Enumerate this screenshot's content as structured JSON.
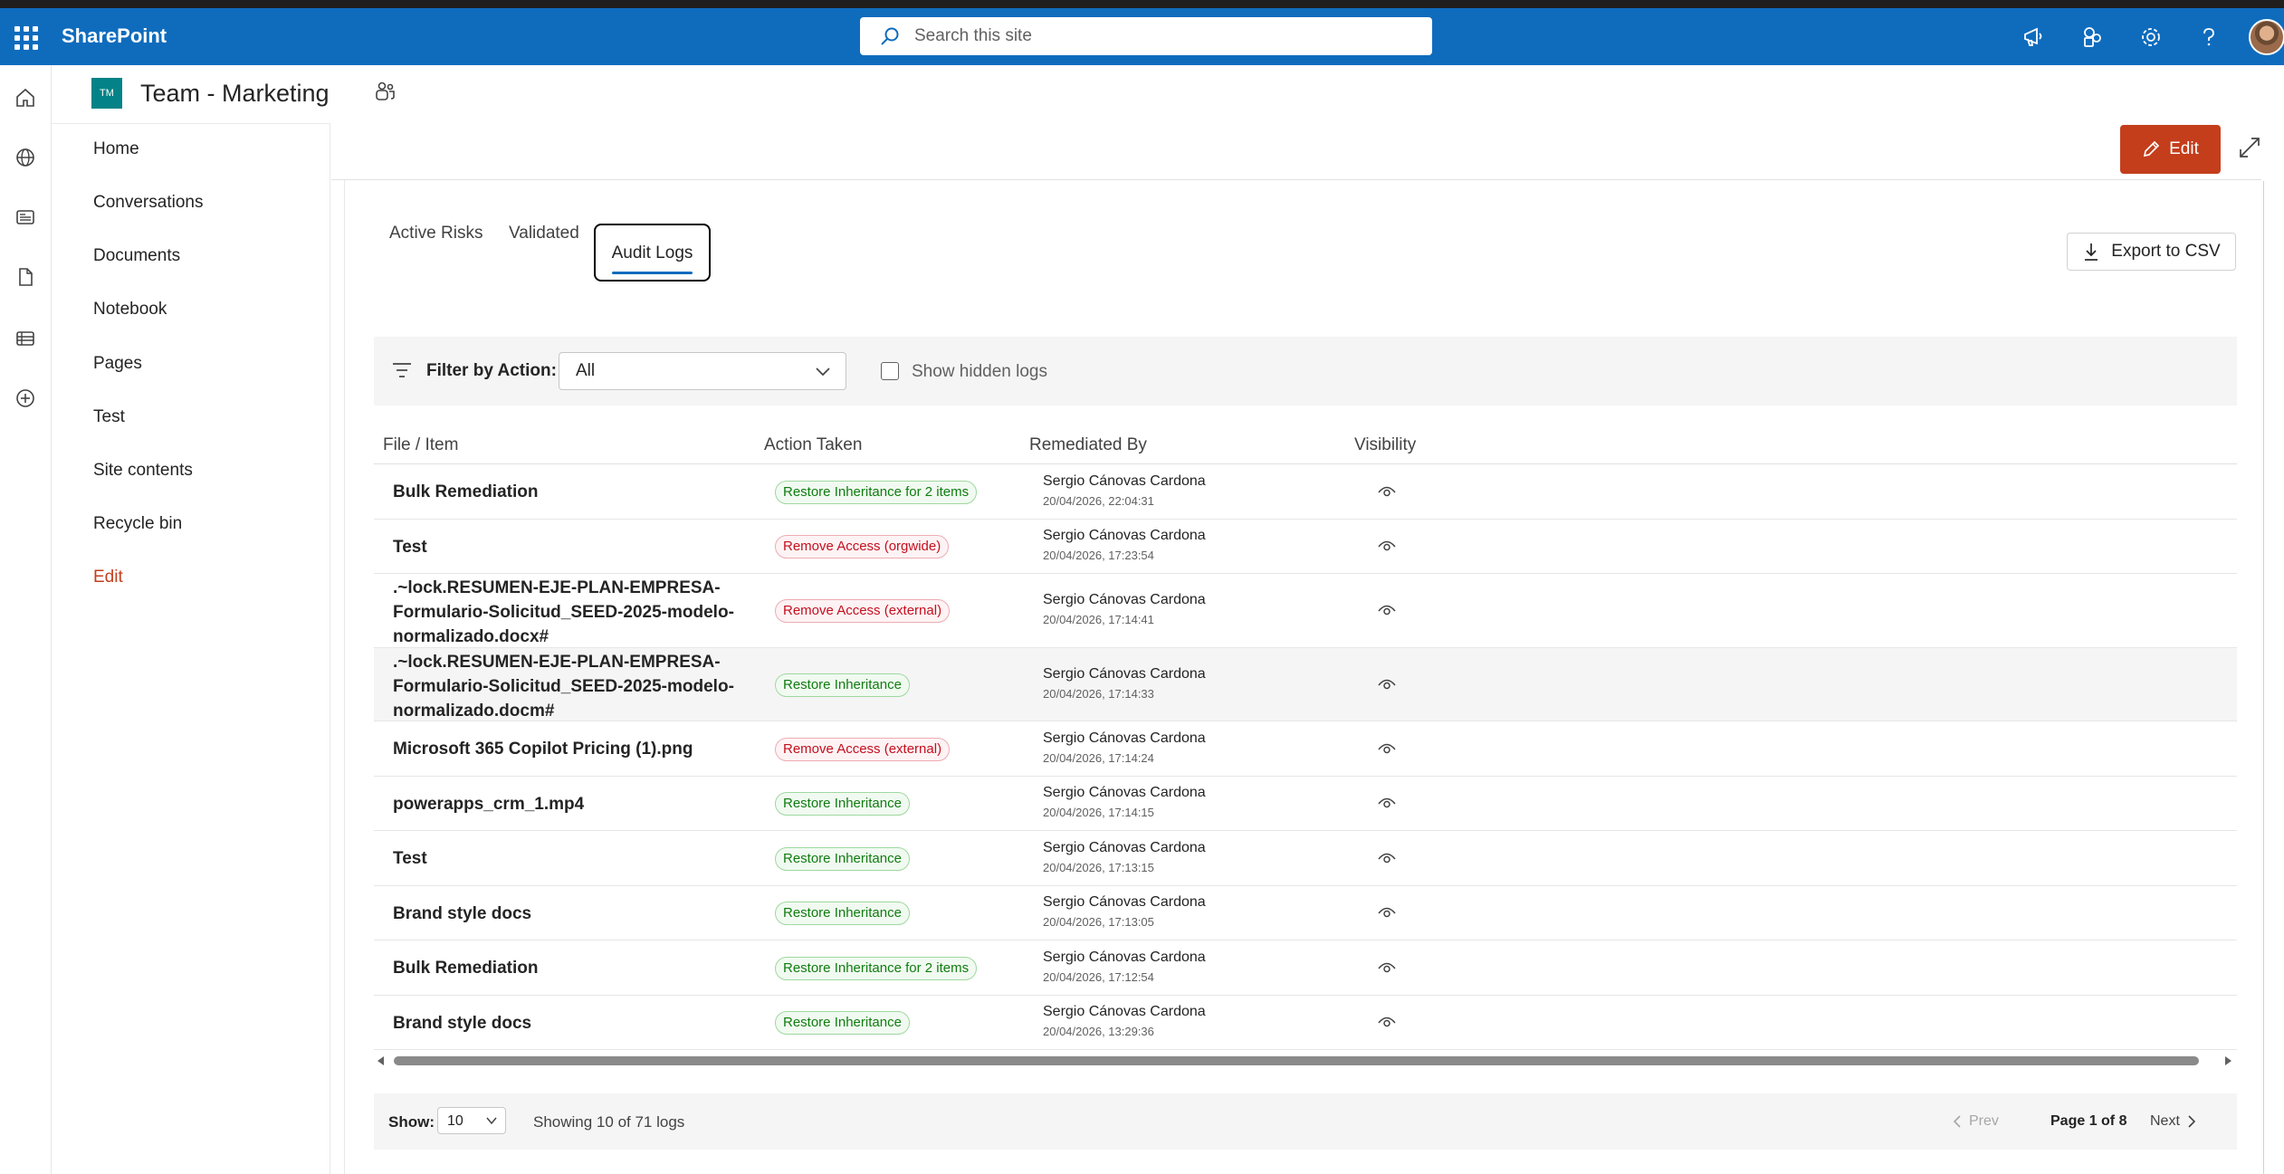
{
  "suite": {
    "app_name": "SharePoint",
    "search_placeholder": "Search this site"
  },
  "site": {
    "logo_initials": "TM",
    "title": "Team - Marketing"
  },
  "nav": {
    "items": [
      "Home",
      "Conversations",
      "Documents",
      "Notebook",
      "Pages",
      "Test",
      "Site contents",
      "Recycle bin"
    ],
    "edit_label": "Edit"
  },
  "commandbar": {
    "edit_label": "Edit"
  },
  "tabs": [
    {
      "label": "Active Risks",
      "active": false
    },
    {
      "label": "Validated",
      "active": false
    },
    {
      "label": "Audit Logs",
      "active": true
    }
  ],
  "export_label": "Export to CSV",
  "filter": {
    "label": "Filter by Action:",
    "value": "All",
    "show_hidden_label": "Show hidden logs",
    "show_hidden_checked": false
  },
  "table": {
    "columns": [
      "File / Item",
      "Action Taken",
      "Remediated By",
      "Visibility"
    ],
    "rows": [
      {
        "file": "Bulk Remediation",
        "action": "Restore Inheritance for 2 items",
        "tone": "green",
        "by": "Sergio Cánovas Cardona",
        "date": "20/04/2026, 22:04:31",
        "visibility": "eye-icon"
      },
      {
        "file": "Test",
        "action": "Remove Access (orgwide)",
        "tone": "red",
        "by": "Sergio Cánovas Cardona",
        "date": "20/04/2026, 17:23:54",
        "visibility": "eye-icon"
      },
      {
        "file": ".~lock.RESUMEN-EJE-PLAN-EMPRESA-Formulario-Solicitud_SEED-2025-modelo-normalizado.docx#",
        "action": "Remove Access (external)",
        "tone": "red",
        "by": "Sergio Cánovas Cardona",
        "date": "20/04/2026, 17:14:41",
        "visibility": "eye-icon"
      },
      {
        "file": ".~lock.RESUMEN-EJE-PLAN-EMPRESA-Formulario-Solicitud_SEED-2025-modelo-normalizado.docm#",
        "action": "Restore Inheritance",
        "tone": "green",
        "by": "Sergio Cánovas Cardona",
        "date": "20/04/2026, 17:14:33",
        "visibility": "eye-icon"
      },
      {
        "file": "Microsoft 365 Copilot Pricing (1).png",
        "action": "Remove Access (external)",
        "tone": "red",
        "by": "Sergio Cánovas Cardona",
        "date": "20/04/2026, 17:14:24",
        "visibility": "eye-icon"
      },
      {
        "file": "powerapps_crm_1.mp4",
        "action": "Restore Inheritance",
        "tone": "green",
        "by": "Sergio Cánovas Cardona",
        "date": "20/04/2026, 17:14:15",
        "visibility": "eye-icon"
      },
      {
        "file": "Test",
        "action": "Restore Inheritance",
        "tone": "green",
        "by": "Sergio Cánovas Cardona",
        "date": "20/04/2026, 17:13:15",
        "visibility": "eye-icon"
      },
      {
        "file": "Brand style docs",
        "action": "Restore Inheritance",
        "tone": "green",
        "by": "Sergio Cánovas Cardona",
        "date": "20/04/2026, 17:13:05",
        "visibility": "eye-icon"
      },
      {
        "file": "Bulk Remediation",
        "action": "Restore Inheritance for 2 items",
        "tone": "green",
        "by": "Sergio Cánovas Cardona",
        "date": "20/04/2026, 17:12:54",
        "visibility": "eye-icon"
      },
      {
        "file": "Brand style docs",
        "action": "Restore Inheritance",
        "tone": "green",
        "by": "Sergio Cánovas Cardona",
        "date": "20/04/2026, 13:29:36",
        "visibility": "eye-icon"
      }
    ]
  },
  "pagination": {
    "show_label": "Show:",
    "page_size": "10",
    "summary": "Showing 10 of 71 logs",
    "prev_label": "Prev",
    "page_info": "Page 1 of 8",
    "next_label": "Next"
  },
  "colors": {
    "suite_bar": "#0f6cbd",
    "edit_button": "#c43e1c",
    "badge_green": "#107c10",
    "badge_red": "#c50f1f"
  }
}
